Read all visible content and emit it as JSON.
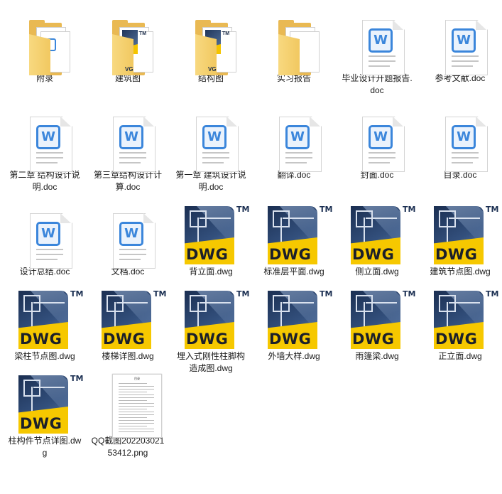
{
  "items": [
    {
      "kind": "folder-docs",
      "label": "附录"
    },
    {
      "kind": "folder-dwg",
      "label": "建筑图"
    },
    {
      "kind": "folder-dwg",
      "label": "结构图"
    },
    {
      "kind": "folder-plain",
      "label": "实习报告"
    },
    {
      "kind": "doc",
      "label": "毕业设计开题报告.doc"
    },
    {
      "kind": "doc",
      "label": "参考文献.doc"
    },
    {
      "kind": "doc",
      "label": "第二章 结构设计说明.doc"
    },
    {
      "kind": "doc",
      "label": "第三章结构设计计算.doc"
    },
    {
      "kind": "doc",
      "label": "第一章 建筑设计说明.doc"
    },
    {
      "kind": "doc",
      "label": "翻译.doc"
    },
    {
      "kind": "doc",
      "label": "封面.doc"
    },
    {
      "kind": "doc",
      "label": "目录.doc"
    },
    {
      "kind": "doc",
      "label": "设计总结.doc"
    },
    {
      "kind": "doc",
      "label": "文档.doc"
    },
    {
      "kind": "dwg",
      "label": "背立面.dwg"
    },
    {
      "kind": "dwg",
      "label": "标准层平面.dwg"
    },
    {
      "kind": "dwg",
      "label": "侧立面.dwg"
    },
    {
      "kind": "dwg",
      "label": "建筑节点图.dwg"
    },
    {
      "kind": "dwg",
      "label": "梁柱节点图.dwg"
    },
    {
      "kind": "dwg",
      "label": "楼梯详图.dwg"
    },
    {
      "kind": "dwg",
      "label": "埋入式刚性柱脚构造成图.dwg"
    },
    {
      "kind": "dwg",
      "label": "外墙大样.dwg"
    },
    {
      "kind": "dwg",
      "label": "雨篷梁.dwg"
    },
    {
      "kind": "dwg",
      "label": "正立面.dwg"
    },
    {
      "kind": "dwg",
      "label": "柱构件节点详图.dwg"
    },
    {
      "kind": "png",
      "label": "QQ截图20220302153412.png"
    }
  ],
  "dwg_badge": {
    "text": "DWG",
    "tm": "TM"
  },
  "word_badge": "W",
  "mini_badge": {
    "tm": "TM",
    "text": "VG"
  },
  "png_preview_title": "目录",
  "colors": {
    "folder": "#e9b953",
    "word_blue": "#3b86db",
    "dwg_navy": "#1b2f52",
    "dwg_yellow": "#f6c800"
  }
}
